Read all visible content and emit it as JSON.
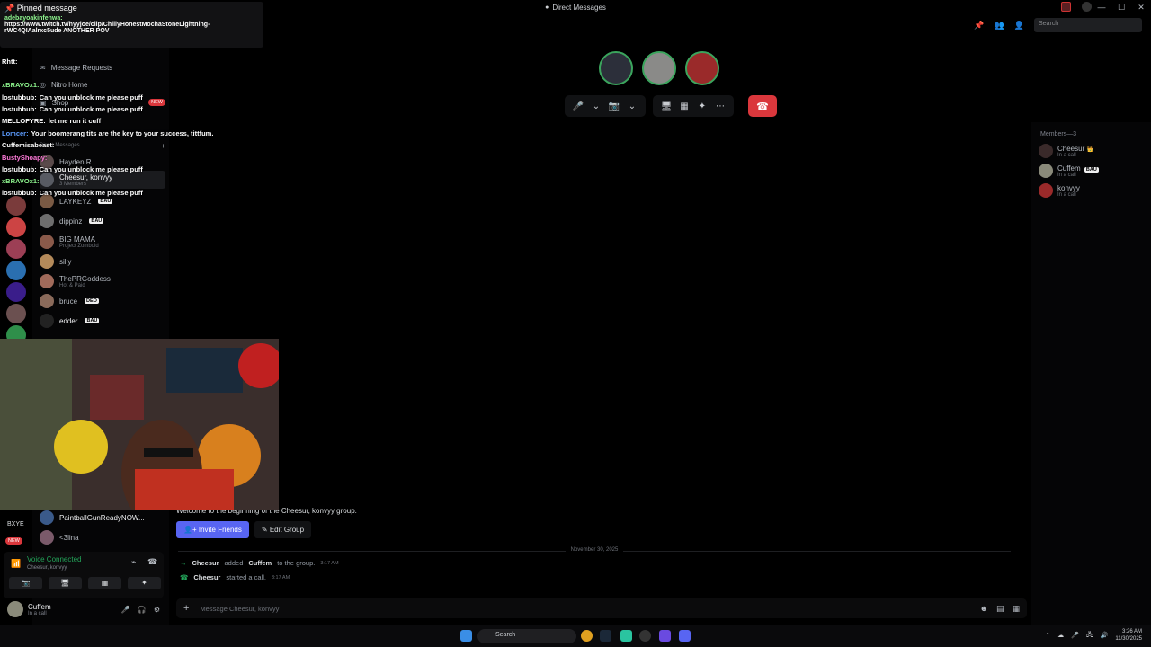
{
  "window": {
    "title": "Direct Messages",
    "controls": [
      "—",
      "☐",
      "✕"
    ]
  },
  "pinned": {
    "title": "Pinned message",
    "user": "adebayoakinfenwa:",
    "text": "https://www.twitch.tv/hyyjoe/clip/ChillyHonestMochaStoneLightning-rWC4QIAalrxc5ude ANOTHER POV"
  },
  "chat_overlay": [
    {
      "user": "Rhtt:",
      "msg": "",
      "color": "#ffffff"
    },
    {
      "user": "xBRAVOx1:",
      "msg": "",
      "color": "#8ef58e"
    },
    {
      "user": "lostubbub:",
      "msg": "Can you unblock me please puff",
      "color": "#ffffff"
    },
    {
      "user": "lostubbub:",
      "msg": "Can you unblock me please puff",
      "color": "#ffffff"
    },
    {
      "user": "MELLOFYRE:",
      "msg": "let me run it cuff",
      "color": "#ffffff"
    },
    {
      "user": "Lomcer:",
      "msg": "Your boomerang tits are the key to your success, tittfum.",
      "color": "#5c9cff"
    },
    {
      "user": "Cuffemisabeast:",
      "msg": "",
      "color": "#ffffff"
    },
    {
      "user": "BustyShoapy:",
      "msg": "",
      "color": "#ff7ad9"
    },
    {
      "user": "lostubbub:",
      "msg": "Can you unblock me please puff",
      "color": "#ffffff"
    },
    {
      "user": "xBRAVOx1:",
      "msg": "",
      "color": "#8ef58e"
    },
    {
      "user": "lostubbub:",
      "msg": "Can you unblock me please puff",
      "color": "#ffffff"
    }
  ],
  "dm_nav": {
    "message_requests": "Message Requests",
    "nitro_home": "Nitro Home",
    "shop": "Shop",
    "shop_badge": "NEW",
    "direct_messages": "Direct Messages",
    "add": "+"
  },
  "dm_list": [
    {
      "name": "Hayden R.",
      "sub": "",
      "badge": ""
    },
    {
      "name": "Cheesur, konvyy",
      "sub": "3 Members",
      "badge": ""
    },
    {
      "name": "LAYKEYZ",
      "sub": "",
      "badge": "BAU"
    },
    {
      "name": "dippinz",
      "sub": "",
      "badge": "BAU"
    },
    {
      "name": "BIG MAMA",
      "sub": "Project Zomboid",
      "badge": ""
    },
    {
      "name": "silly",
      "sub": "",
      "badge": ""
    },
    {
      "name": "ThePRGoddess",
      "sub": "Hot & Paid",
      "badge": ""
    },
    {
      "name": "bruce",
      "sub": "",
      "badge": "DEO"
    },
    {
      "name": "edder",
      "sub": "",
      "badge": "BAU"
    },
    {
      "name": "PaintballGunReadyNOW...",
      "sub": "",
      "badge": ""
    },
    {
      "name": "<3lina",
      "sub": "",
      "badge": ""
    }
  ],
  "server_label": "BXYE",
  "server_badge": "NEW",
  "voice": {
    "status": "Voice Connected",
    "channel": "Cheesur, konvyy",
    "buttons": [
      "📷",
      "🖥",
      "▦",
      "✦"
    ]
  },
  "user": {
    "name": "Cuffem",
    "status": "In a call"
  },
  "top_tools": {
    "search_placeholder": "Search"
  },
  "call": {
    "controls": [
      "🎤",
      "⌄",
      "📷",
      "⌄",
      "🖥",
      "▦",
      "✦",
      "⋯"
    ],
    "end": "☎"
  },
  "chat": {
    "welcome": "Welcome to the beginning of the Cheesur, konvyy group.",
    "invite_btn": "Invite Friends",
    "edit_btn": "Edit Group",
    "date": "November 30, 2025",
    "messages": [
      {
        "actor": "Cheesur",
        "action": "added",
        "target": "Cuffem",
        "rest": "to the group.",
        "time": "3:17 AM",
        "icon": "→"
      },
      {
        "actor": "Cheesur",
        "action": "started a call.",
        "target": "",
        "rest": "",
        "time": "3:17 AM",
        "icon": "☎"
      }
    ],
    "composer_placeholder": "Message Cheesur, konvyy"
  },
  "members": {
    "title": "Members—3",
    "list": [
      {
        "name": "Cheesur",
        "status": "In a call",
        "badge": "👑"
      },
      {
        "name": "Cuffem",
        "status": "In a call",
        "badge": "BAU"
      },
      {
        "name": "konvyy",
        "status": "In a call",
        "badge": ""
      }
    ]
  },
  "taskbar": {
    "search": "Search",
    "time": "3:26 AM",
    "date": "11/30/2025"
  },
  "colors": {
    "accent": "#5865f2",
    "online": "#23a55a",
    "danger": "#da373c"
  }
}
